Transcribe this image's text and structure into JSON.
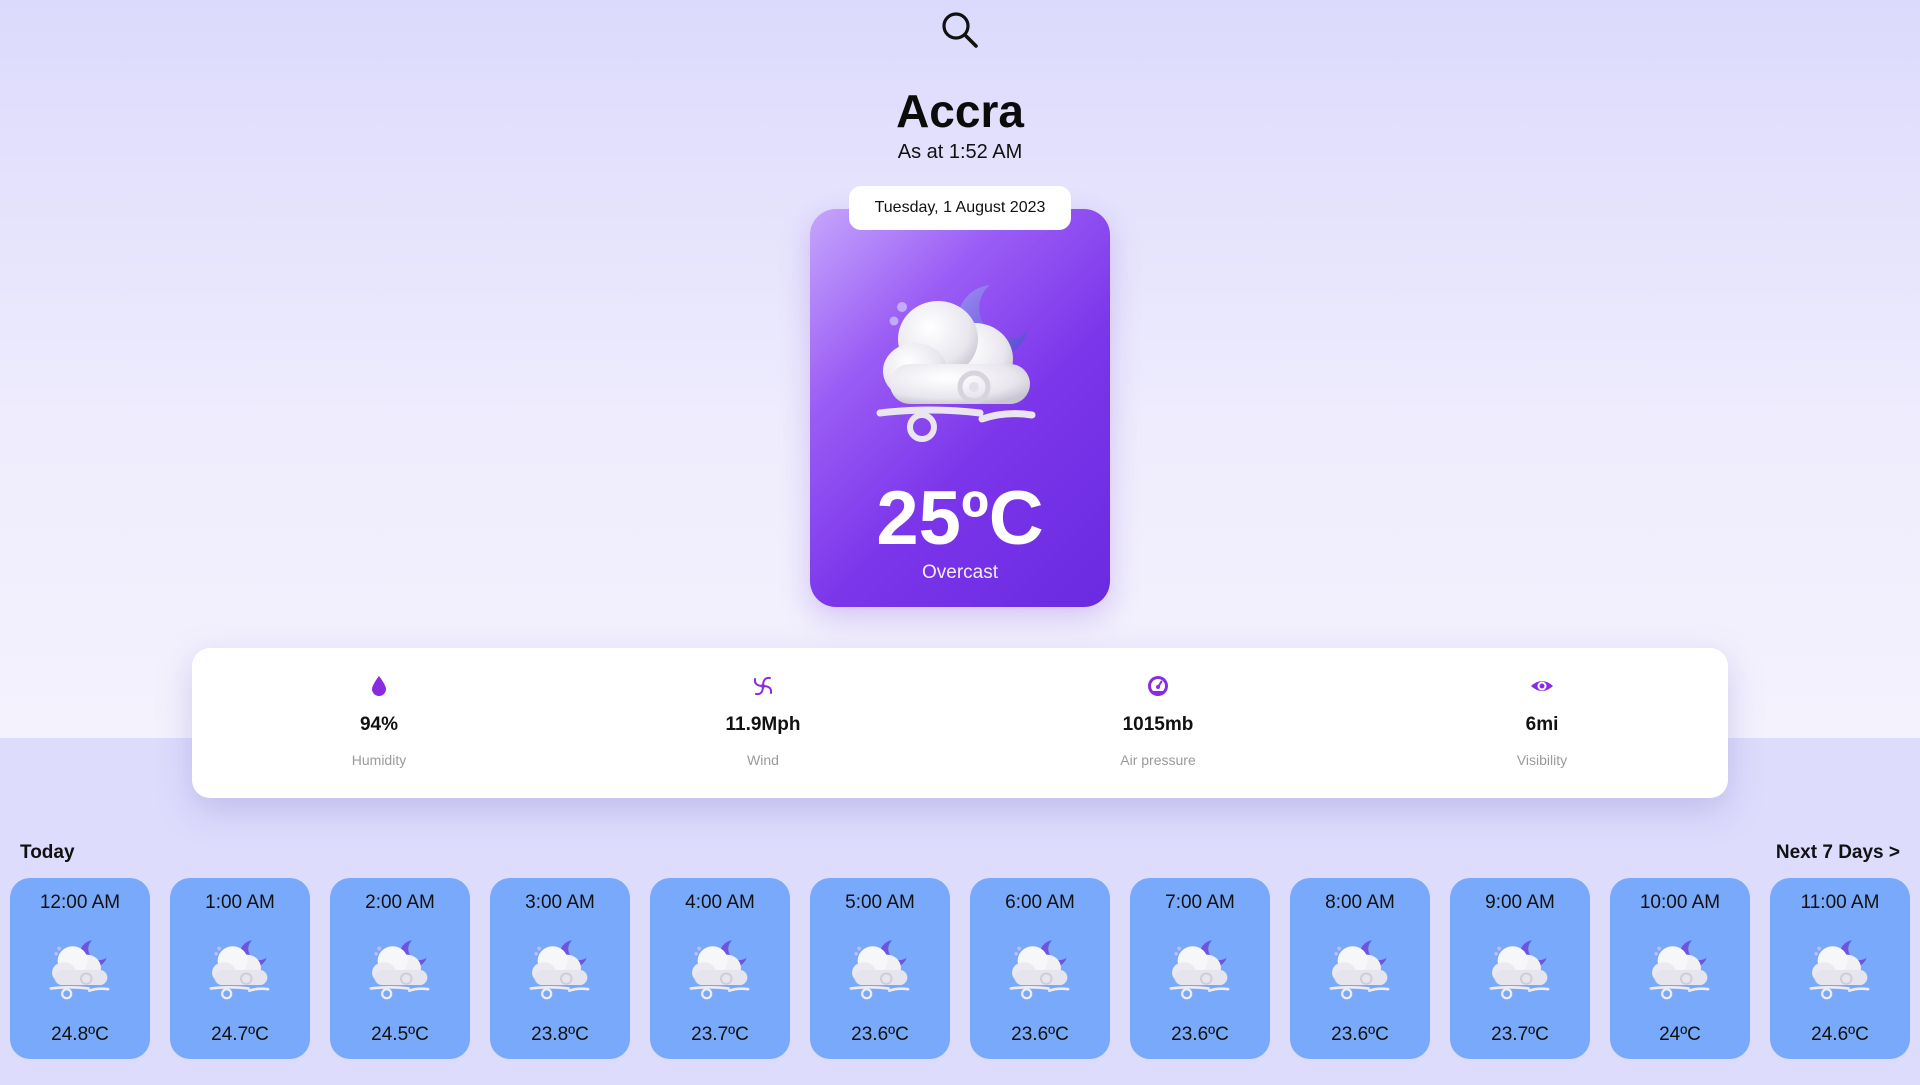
{
  "icons": {
    "search": "search-icon",
    "weather": "cloud-moon-wind-icon",
    "humidity": "water-drop-icon",
    "wind": "wind-spiral-icon",
    "pressure": "gauge-icon",
    "visibility": "eye-icon"
  },
  "colors": {
    "accent": "#7b35ea",
    "hour_card": "#79a9fa",
    "background": "#dddbfd"
  },
  "location": {
    "city": "Accra",
    "as_at": "As at 1:52 AM"
  },
  "current": {
    "date": "Tuesday, 1 August 2023",
    "temperature": "25ºC",
    "condition": "Overcast"
  },
  "stats": [
    {
      "value": "94%",
      "label": "Humidity",
      "icon": "water-drop-icon"
    },
    {
      "value": "11.9Mph",
      "label": "Wind",
      "icon": "wind-spiral-icon"
    },
    {
      "value": "1015mb",
      "label": "Air pressure",
      "icon": "gauge-icon"
    },
    {
      "value": "6mi",
      "label": "Visibility",
      "icon": "eye-icon"
    }
  ],
  "forecast": {
    "today_label": "Today",
    "next_link": "Next 7 Days >",
    "hours": [
      {
        "time": "12:00 AM",
        "temp": "24.8ºC"
      },
      {
        "time": "1:00 AM",
        "temp": "24.7ºC"
      },
      {
        "time": "2:00 AM",
        "temp": "24.5ºC"
      },
      {
        "time": "3:00 AM",
        "temp": "23.8ºC"
      },
      {
        "time": "4:00 AM",
        "temp": "23.7ºC"
      },
      {
        "time": "5:00 AM",
        "temp": "23.6ºC"
      },
      {
        "time": "6:00 AM",
        "temp": "23.6ºC"
      },
      {
        "time": "7:00 AM",
        "temp": "23.6ºC"
      },
      {
        "time": "8:00 AM",
        "temp": "23.6ºC"
      },
      {
        "time": "9:00 AM",
        "temp": "23.7ºC"
      },
      {
        "time": "10:00 AM",
        "temp": "24ºC"
      },
      {
        "time": "11:00 AM",
        "temp": "24.6ºC"
      }
    ]
  }
}
